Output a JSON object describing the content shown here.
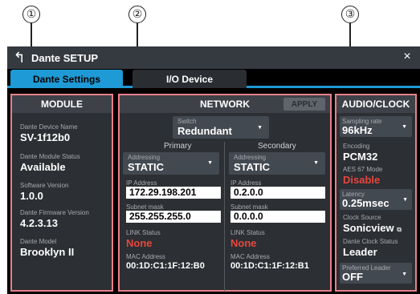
{
  "callouts": {
    "module": "①",
    "network": "②",
    "audio_clock": "③"
  },
  "titlebar": {
    "title": "Dante SETUP",
    "back_icon": "↰",
    "close_icon": "×"
  },
  "tabs": [
    {
      "label": "Dante Settings",
      "active": true
    },
    {
      "label": "I/O Device",
      "active": false
    }
  ],
  "module": {
    "heading": "MODULE",
    "device_name_label": "Dante Device Name",
    "device_name": "SV-1f12b0",
    "status_label": "Dante Module Status",
    "status": "Available",
    "sw_label": "Software Version",
    "sw": "1.0.0",
    "fw_label": "Dante Firmware Version",
    "fw": "4.2.3.13",
    "model_label": "Dante Model",
    "model": "Brooklyn II"
  },
  "network": {
    "heading": "NETWORK",
    "apply_label": "APPLY",
    "switch_caption": "Switch",
    "switch_value": "Redundant",
    "primary": {
      "heading": "Primary",
      "addressing_caption": "Addressing",
      "addressing": "STATIC",
      "ip_label": "IP Address",
      "ip": "172.29.198.201",
      "mask_label": "Subnet mask",
      "mask": "255.255.255.0",
      "link_label": "LINK Status",
      "link": "None",
      "mac_label": "MAC Address",
      "mac": "00:1D:C1:1F:12:B0"
    },
    "secondary": {
      "heading": "Secondary",
      "addressing_caption": "Addressing",
      "addressing": "STATIC",
      "ip_label": "IP Address",
      "ip": "0.2.0.0",
      "mask_label": "Subnet mask",
      "mask": "0.0.0.0",
      "link_label": "LINK Status",
      "link": "None",
      "mac_label": "MAC Address",
      "mac": "00:1D:C1:1F:12:B1"
    }
  },
  "audio_clock": {
    "heading": "AUDIO/CLOCK",
    "sampling_label": "Sampling rate",
    "sampling": "96kHz",
    "encoding_label": "Encoding",
    "encoding": "PCM32",
    "aes_label": "AES 67 Mode",
    "aes": "Disable",
    "latency_label": "Latency",
    "latency": "0.25msec",
    "clock_source_label": "Clock Source",
    "clock_source": "Sonicview",
    "clock_status_label": "Dante Clock Status",
    "clock_status": "Leader",
    "pref_leader_label": "Preferred Leader",
    "pref_leader": "OFF"
  },
  "colors": {
    "accent": "#1e9ad6",
    "highlight": "#e8808a",
    "alert": "#e8463c"
  },
  "icons": {
    "dropdown_arrow": "▼",
    "external_link": "⧉"
  }
}
